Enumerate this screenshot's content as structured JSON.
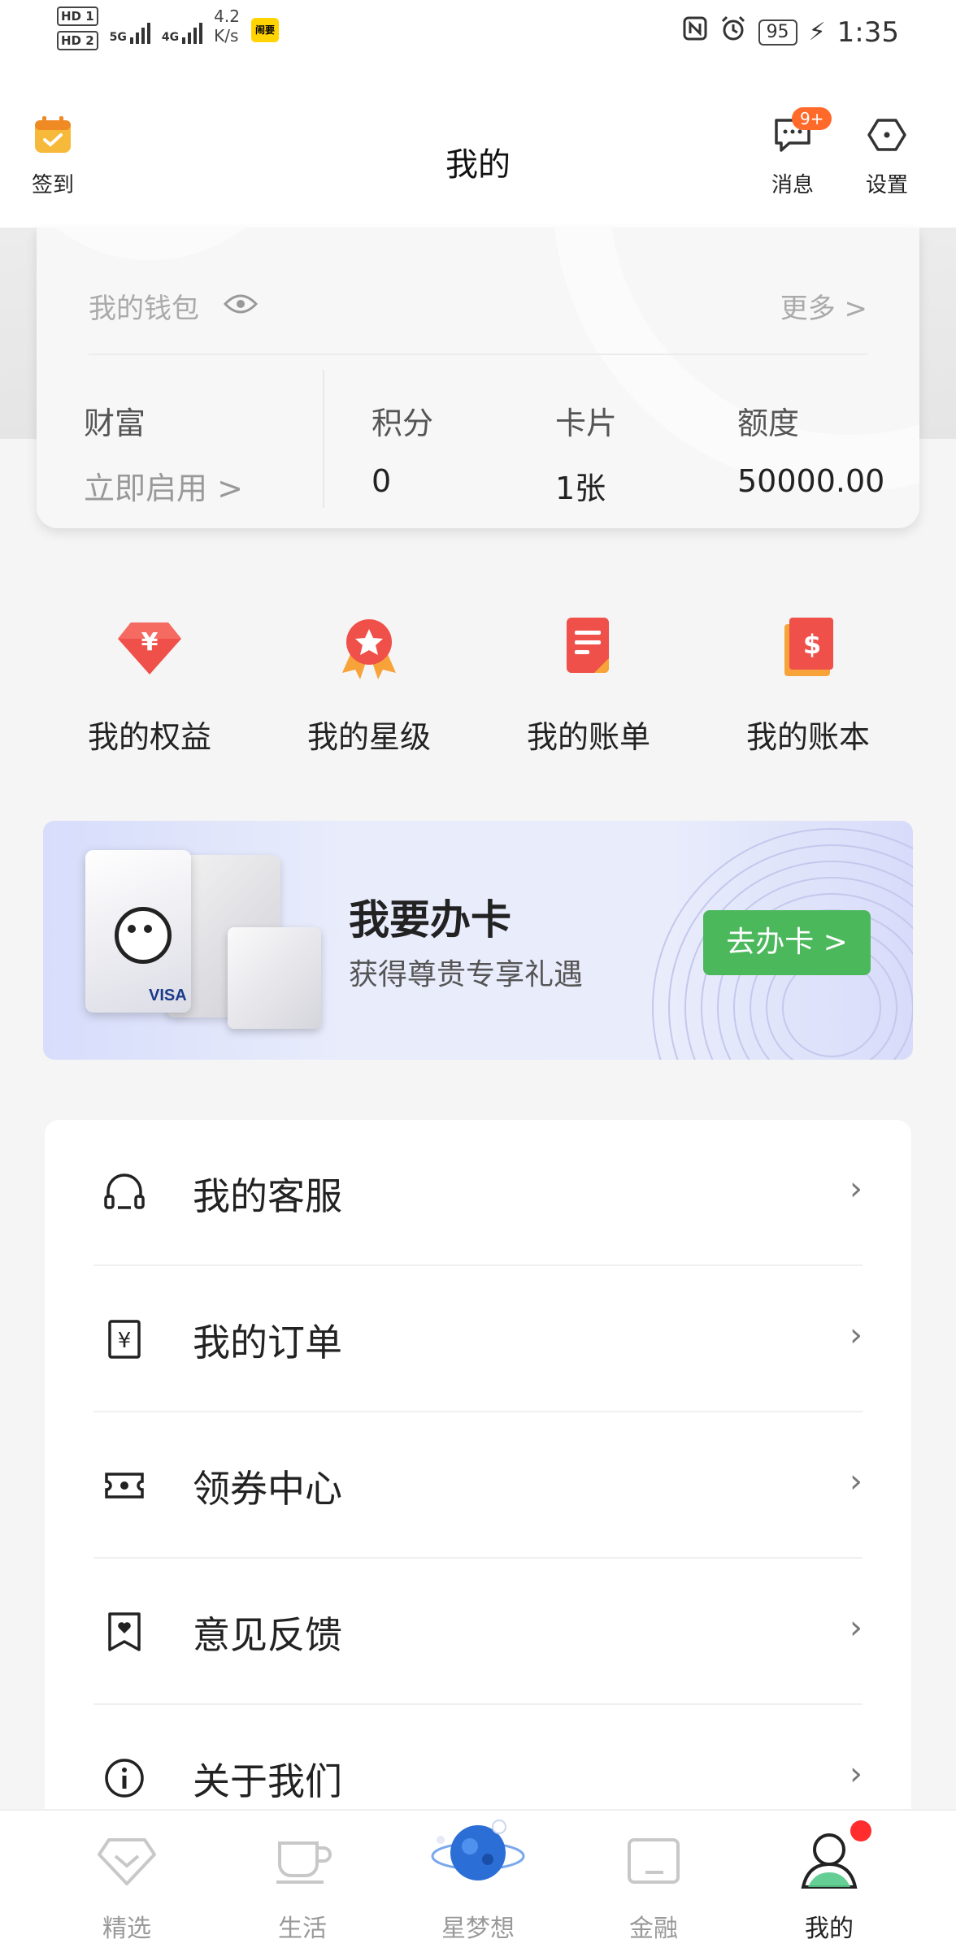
{
  "status_bar": {
    "hd1": "HD 1",
    "hd2": "HD 2",
    "net1": "5G",
    "net2": "4G",
    "speed_value": "4.2",
    "speed_unit": "K/s",
    "app_badge": "闹要",
    "battery": "95",
    "time": "1:35"
  },
  "header": {
    "checkin_label": "签到",
    "title": "我的",
    "messages_label": "消息",
    "messages_badge": "9+",
    "settings_label": "设置"
  },
  "wallet": {
    "title": "我的钱包",
    "more": "更多 >",
    "wealth_label": "财富",
    "wealth_action": "立即启用 >",
    "points_label": "积分",
    "points_value": "0",
    "cards_label": "卡片",
    "cards_value": "1张",
    "limit_label": "额度",
    "limit_value": "50000.00"
  },
  "quick_actions": [
    {
      "label": "我的权益",
      "icon": "diamond-yuan-icon"
    },
    {
      "label": "我的星级",
      "icon": "star-medal-icon"
    },
    {
      "label": "我的账单",
      "icon": "bill-icon"
    },
    {
      "label": "我的账本",
      "icon": "dollar-book-icon"
    }
  ],
  "banner": {
    "title": "我要办卡",
    "subtitle": "获得尊贵专享礼遇",
    "button": "去办卡 >"
  },
  "menu": [
    {
      "label": "我的客服",
      "icon": "headset-icon"
    },
    {
      "label": "我的订单",
      "icon": "yuan-receipt-icon"
    },
    {
      "label": "领券中心",
      "icon": "ticket-icon"
    },
    {
      "label": "意见反馈",
      "icon": "feedback-bookmark-icon"
    },
    {
      "label": "关于我们",
      "icon": "info-icon"
    }
  ],
  "tabbar": [
    {
      "label": "精选",
      "icon": "diamond-icon"
    },
    {
      "label": "生活",
      "icon": "cup-icon"
    },
    {
      "label": "星梦想",
      "icon": "planet-icon"
    },
    {
      "label": "金融",
      "icon": "wallet-icon"
    },
    {
      "label": "我的",
      "icon": "user-icon",
      "active": true
    }
  ],
  "colors": {
    "accent_green": "#4cb85c",
    "badge_orange": "#ff6a2a",
    "icon_red": "#f0504a",
    "notification_red": "#ff2d2d"
  }
}
